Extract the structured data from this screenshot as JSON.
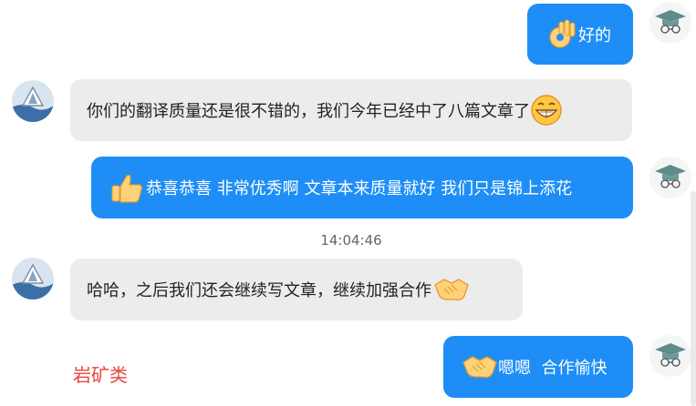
{
  "messages": [
    {
      "side": "right",
      "emoji": "ok-hand-emoji",
      "text": "好的"
    },
    {
      "side": "left",
      "emoji": "grinning-face-emoji",
      "text": "你们的翻译质量还是很不错的，我们今年已经中了八篇文章了"
    },
    {
      "side": "right",
      "emoji": "thumbs-up-emoji",
      "text": "恭喜恭喜 非常优秀啊 文章本来质量就好 我们只是锦上添花"
    },
    {
      "side": "left",
      "emoji": "handshake-emoji",
      "text": "哈哈，之后我们还会继续写文章，继续加强合作"
    },
    {
      "side": "right",
      "emoji": "handshake-emoji",
      "text": "嗯嗯  合作愉快"
    }
  ],
  "timestamp": "14:04:46",
  "side_label": "岩矿类",
  "colors": {
    "bubble_self": "#1e8ef6",
    "bubble_other": "#ececec",
    "label_red": "#e8453c"
  }
}
